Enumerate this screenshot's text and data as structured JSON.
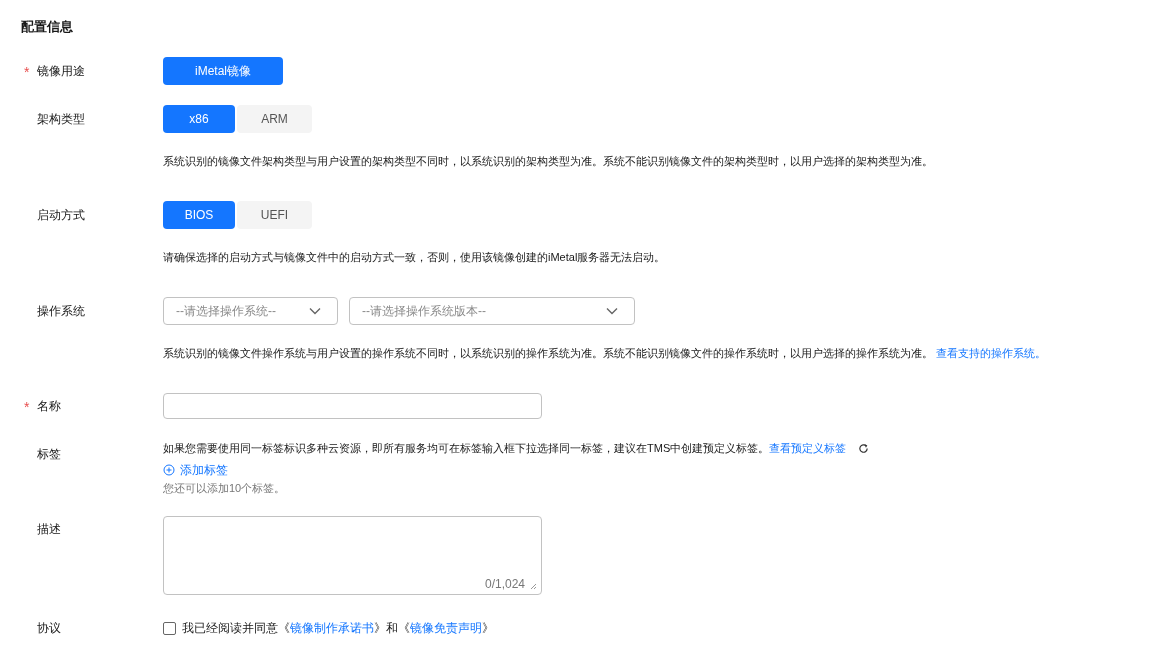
{
  "section_title": "配置信息",
  "fields": [
    {
      "kind": "segmented",
      "label": "镜像用途",
      "required_mark": "*",
      "options": [
        {
          "label": "iMetal镜像",
          "selected": true
        }
      ]
    },
    {
      "kind": "segmented",
      "label": "架构类型",
      "options": [
        {
          "label": "x86",
          "selected": true
        },
        {
          "label": "ARM",
          "selected": false
        }
      ],
      "hint": "系统识别的镜像文件架构类型与用户设置的架构类型不同时，以系统识别的架构类型为准。系统不能识别镜像文件的架构类型时，以用户选择的架构类型为准。"
    },
    {
      "kind": "segmented",
      "label": "启动方式",
      "options": [
        {
          "label": "BIOS",
          "selected": true
        },
        {
          "label": "UEFI",
          "selected": false
        }
      ],
      "hint": "请确保选择的启动方式与镜像文件中的启动方式一致，否则，使用该镜像创建的iMetal服务器无法启动。"
    },
    {
      "kind": "selects",
      "label": "操作系统",
      "selects": [
        {
          "placeholder": "--请选择操作系统--"
        },
        {
          "placeholder": "--请选择操作系统版本--"
        }
      ],
      "hint": "系统识别的镜像文件操作系统与用户设置的操作系统不同时，以系统识别的操作系统为准。系统不能识别镜像文件的操作系统时，以用户选择的操作系统为准。",
      "hint_link": "查看支持的操作系统。"
    },
    {
      "kind": "input",
      "label": "名称",
      "required_mark": "*"
    },
    {
      "kind": "tags",
      "label": "标签",
      "hint": "如果您需要使用同一标签标识多种云资源，即所有服务均可在标签输入框下拉选择同一标签，建议在TMS中创建预定义标签。",
      "hint_link": "查看预定义标签",
      "add_label": "添加标签",
      "note": "您还可以添加10个标签。"
    },
    {
      "kind": "textarea",
      "label": "描述",
      "counter": "0/1,024"
    },
    {
      "kind": "agreement",
      "label": "协议",
      "checked": false,
      "parts": [
        {
          "kind": "text",
          "text": "我已经阅读并同意《"
        },
        {
          "kind": "link",
          "text": "镜像制作承诺书"
        },
        {
          "kind": "text",
          "text": "》和《"
        },
        {
          "kind": "link",
          "text": "镜像免责声明"
        },
        {
          "kind": "text",
          "text": "》"
        }
      ]
    }
  ]
}
